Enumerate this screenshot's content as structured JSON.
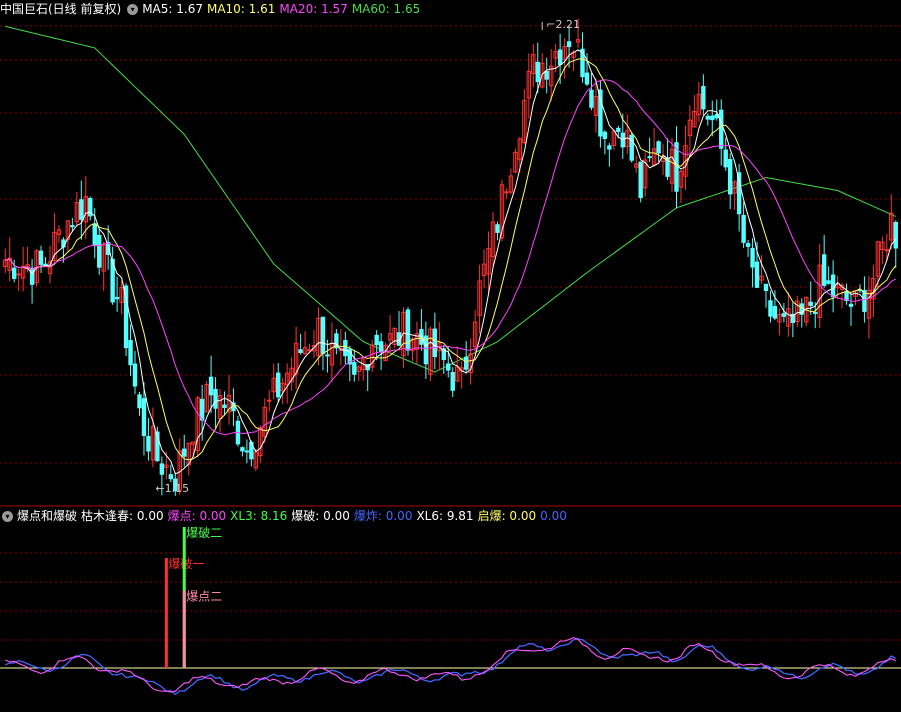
{
  "colors": {
    "bg": "#000000",
    "up": "#ff3232",
    "down": "#54ffff",
    "ma5": "#ffffff",
    "ma10": "#ffff66",
    "ma20": "#ff44ff",
    "ma60": "#44dd44",
    "grid": "#8b0000",
    "divider": "#b40000",
    "xl3": "#4466ff",
    "xl6": "#ff55ff"
  },
  "top_panel": {
    "title": "中国巨石(日线 前复权)",
    "legend": [
      {
        "label": "MA5: 1.67",
        "color": "#ffffff"
      },
      {
        "label": "MA10: 1.61",
        "color": "#ffff66"
      },
      {
        "label": "MA20: 1.57",
        "color": "#ff44ff"
      },
      {
        "label": "MA60: 1.65",
        "color": "#44dd44"
      }
    ],
    "high_label": "2.21",
    "low_label": "1.15"
  },
  "bottom_panel": {
    "title": "爆点和爆破",
    "legend": [
      {
        "label": "枯木逢春: 0.00",
        "color": "#ffffff"
      },
      {
        "label": "爆点: 0.00",
        "color": "#ff44ff"
      },
      {
        "label": "XL3: 8.16",
        "color": "#44ff44"
      },
      {
        "label": "爆破: 0.00",
        "color": "#ffffff"
      },
      {
        "label": "爆炸: 0.00",
        "color": "#4466ff"
      },
      {
        "label": "XL6: 9.81",
        "color": "#ffffff"
      },
      {
        "label": "启爆: 0.00",
        "color": "#ffff66"
      },
      {
        "label": "0.00",
        "color": "#4466ff"
      }
    ],
    "signals": [
      {
        "label": "爆破一",
        "color": "#ff3232",
        "x_index": 36,
        "height": 0.78
      },
      {
        "label": "爆破二",
        "color": "#44ff44",
        "x_index": 40,
        "height": 1.0
      },
      {
        "label": "爆点二",
        "color": "#ff88aa",
        "x_index": 40,
        "height": 0.55
      }
    ]
  },
  "chart_data": {
    "type": "candlestick",
    "ylim": [
      1.15,
      2.21
    ],
    "bars": 200,
    "price_keypoints": [
      [
        0,
        1.66
      ],
      [
        8,
        1.64
      ],
      [
        14,
        1.75
      ],
      [
        18,
        1.8
      ],
      [
        22,
        1.65
      ],
      [
        26,
        1.55
      ],
      [
        30,
        1.3
      ],
      [
        34,
        1.2
      ],
      [
        38,
        1.16
      ],
      [
        42,
        1.28
      ],
      [
        46,
        1.35
      ],
      [
        50,
        1.32
      ],
      [
        54,
        1.22
      ],
      [
        58,
        1.3
      ],
      [
        62,
        1.38
      ],
      [
        66,
        1.45
      ],
      [
        70,
        1.5
      ],
      [
        74,
        1.42
      ],
      [
        78,
        1.37
      ],
      [
        82,
        1.48
      ],
      [
        86,
        1.47
      ],
      [
        90,
        1.5
      ],
      [
        94,
        1.46
      ],
      [
        98,
        1.42
      ],
      [
        102,
        1.37
      ],
      [
        105,
        1.55
      ],
      [
        110,
        1.75
      ],
      [
        114,
        1.95
      ],
      [
        118,
        2.1
      ],
      [
        122,
        2.13
      ],
      [
        126,
        2.18
      ],
      [
        130,
        2.1
      ],
      [
        134,
        1.95
      ],
      [
        138,
        1.97
      ],
      [
        142,
        1.82
      ],
      [
        146,
        1.93
      ],
      [
        150,
        1.86
      ],
      [
        154,
        2.05
      ],
      [
        158,
        1.98
      ],
      [
        162,
        1.85
      ],
      [
        166,
        1.65
      ],
      [
        170,
        1.55
      ],
      [
        174,
        1.5
      ],
      [
        178,
        1.52
      ],
      [
        182,
        1.6
      ],
      [
        186,
        1.58
      ],
      [
        190,
        1.55
      ],
      [
        194,
        1.62
      ],
      [
        198,
        1.75
      ],
      [
        199,
        1.72
      ]
    ],
    "ma60_path": [
      [
        0,
        2.2
      ],
      [
        20,
        2.15
      ],
      [
        40,
        1.95
      ],
      [
        60,
        1.65
      ],
      [
        80,
        1.47
      ],
      [
        96,
        1.4
      ],
      [
        110,
        1.47
      ],
      [
        130,
        1.63
      ],
      [
        150,
        1.78
      ],
      [
        170,
        1.85
      ],
      [
        186,
        1.82
      ],
      [
        199,
        1.76
      ]
    ],
    "indicator_range": [
      -1,
      1
    ]
  }
}
